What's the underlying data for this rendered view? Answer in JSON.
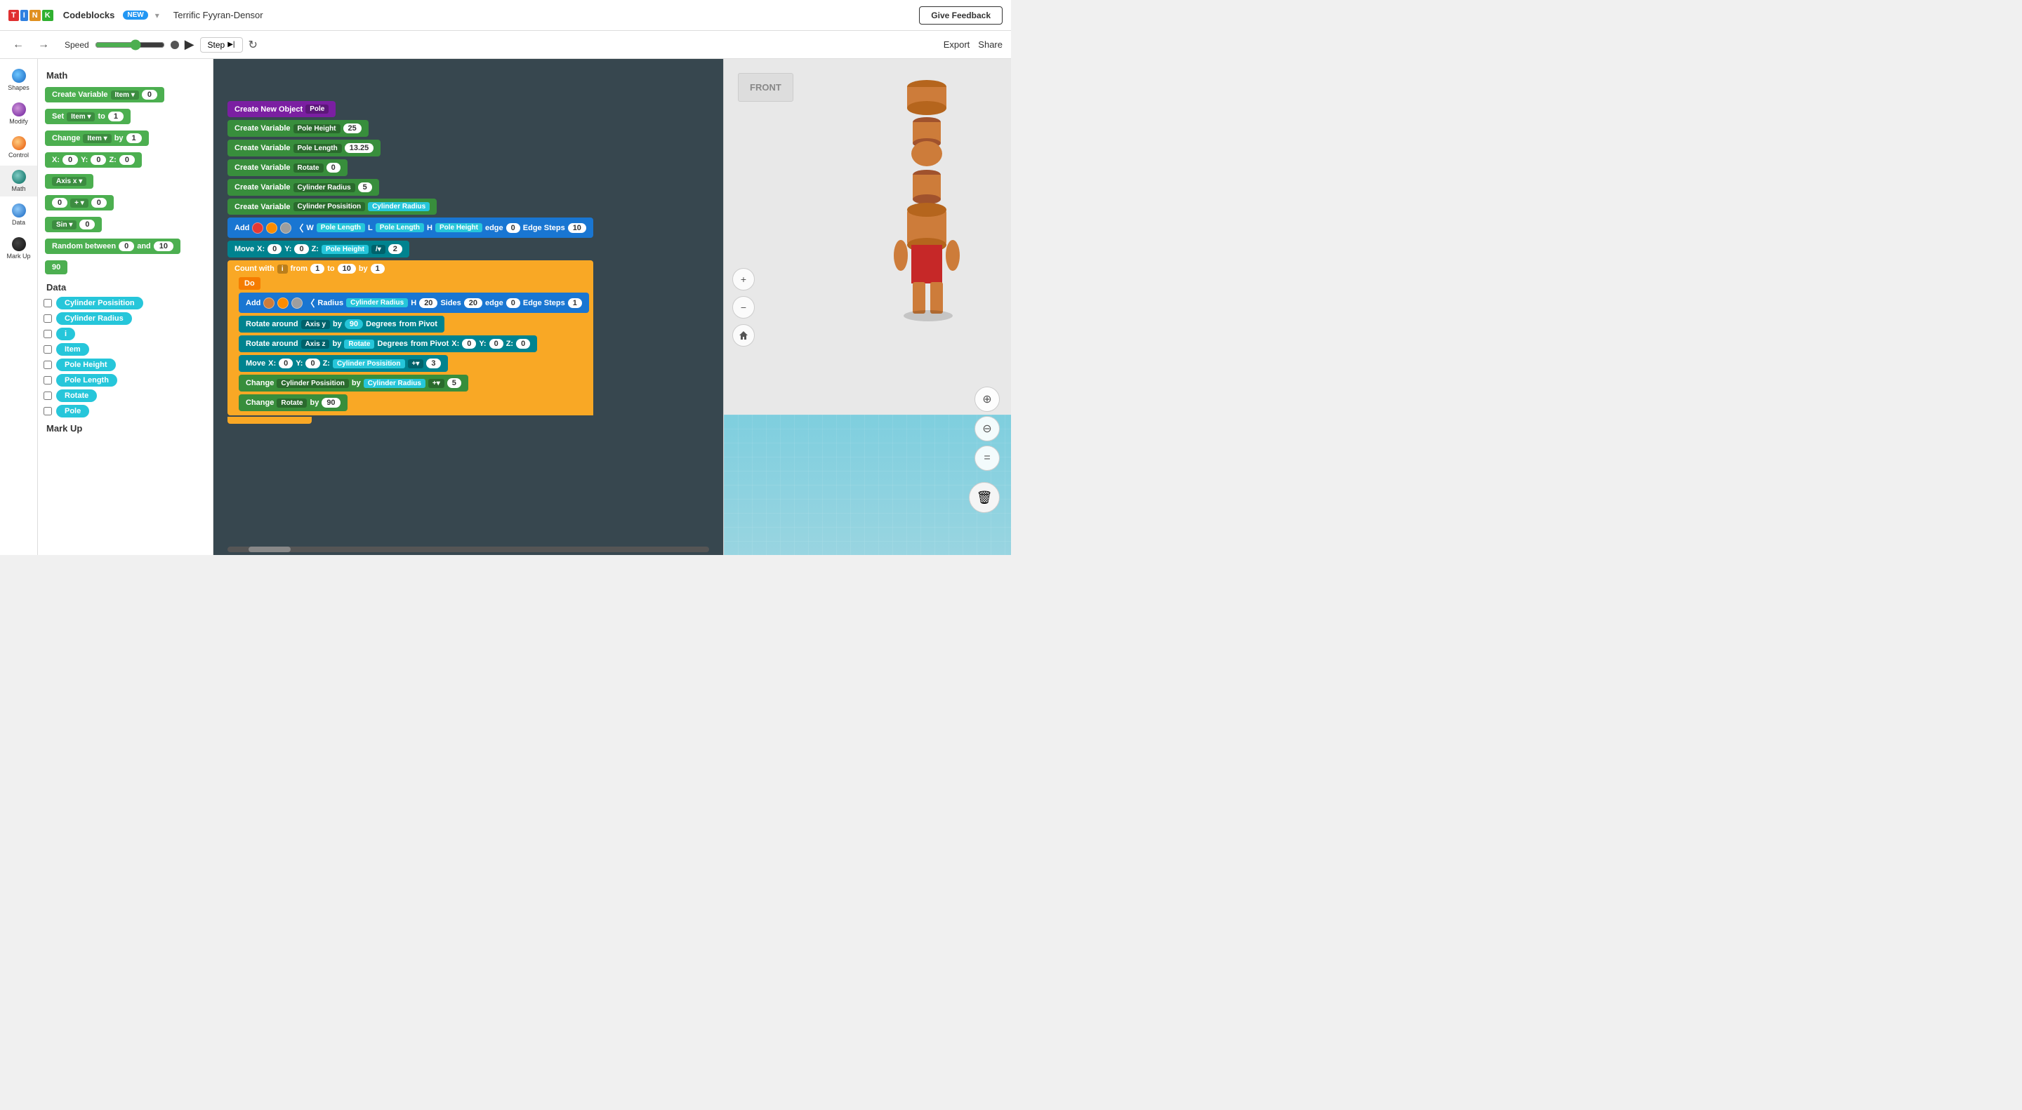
{
  "topbar": {
    "logo": {
      "t": "T",
      "i": "I",
      "n": "N",
      "k": "K"
    },
    "app_name": "Codeblocks",
    "new_badge": "NEW",
    "project_title": "Terrific Fyyran-Densor",
    "give_feedback": "Give Feedback"
  },
  "toolbar": {
    "speed_label": "Speed",
    "step_label": "Step",
    "export_label": "Export",
    "share_label": "Share"
  },
  "sidebar": {
    "items": [
      {
        "label": "Shapes",
        "icon": "shapes-icon"
      },
      {
        "label": "Modify",
        "icon": "modify-icon"
      },
      {
        "label": "Control",
        "icon": "control-icon"
      },
      {
        "label": "Math",
        "icon": "math-icon"
      },
      {
        "label": "Data",
        "icon": "data-icon"
      },
      {
        "label": "Mark Up",
        "icon": "markup-icon"
      }
    ]
  },
  "blocks_panel": {
    "math_title": "Math",
    "data_title": "Data",
    "markup_title": "Mark Up",
    "blocks": [
      {
        "type": "create_variable",
        "label": "Create Variable",
        "var": "Item",
        "val": "0"
      },
      {
        "type": "set",
        "label": "Set",
        "var": "Item",
        "to": "1"
      },
      {
        "type": "change",
        "label": "Change",
        "var": "Item",
        "by": "1"
      },
      {
        "type": "xyz",
        "x": "0",
        "y": "0",
        "z": "0"
      },
      {
        "type": "axis",
        "label": "Axis x"
      },
      {
        "type": "math_op",
        "left": "0",
        "op": "+",
        "right": "0"
      },
      {
        "type": "sin",
        "label": "Sin",
        "val": "0"
      },
      {
        "type": "random",
        "label": "Random between",
        "from": "0",
        "to": "10"
      },
      {
        "type": "number",
        "val": "90"
      }
    ],
    "data_vars": [
      {
        "name": "Cylinder Posisition"
      },
      {
        "name": "Cylinder Radius"
      },
      {
        "name": "i"
      },
      {
        "name": "Item"
      },
      {
        "name": "Pole Height"
      },
      {
        "name": "Pole Length"
      },
      {
        "name": "Rotate"
      },
      {
        "name": "Pole"
      }
    ]
  },
  "code_blocks": {
    "create_new_object": "Create New Object",
    "object_type": "Pole",
    "cv1_label": "Create Variable",
    "cv1_var": "Pole Height",
    "cv1_val": "25",
    "cv2_label": "Create Variable",
    "cv2_var": "Pole Length",
    "cv2_val": "13.25",
    "cv3_label": "Create Variable",
    "cv3_var": "Rotate",
    "cv3_val": "0",
    "cv4_label": "Create Variable",
    "cv4_var": "Cylinder Radius",
    "cv4_val": "5",
    "cv5_label": "Create Variable",
    "cv5_var": "Cylinder Posisition",
    "cv5_ref": "Cylinder Radius",
    "add1_label": "Add",
    "add1_w_label": "W",
    "add1_pole_length": "Pole Length",
    "add1_l_label": "L",
    "add1_pole_length2": "Pole Length",
    "add1_h_label": "H",
    "add1_pole_height": "Pole Height",
    "add1_edge": "edge",
    "add1_edge_val": "0",
    "add1_steps_label": "Edge Steps",
    "add1_steps_val": "10",
    "move1_label": "Move",
    "move1_x": "0",
    "move1_y": "0",
    "move1_z_ref": "Pole Height",
    "move1_op": "/",
    "move1_val": "2",
    "count_label": "Count with",
    "count_var": "i",
    "count_from": "1",
    "count_to": "10",
    "count_by": "1",
    "do_label": "Do",
    "add2_label": "Add",
    "add2_radius_label": "Radius",
    "add2_cyl_radius": "Cylinder Radius",
    "add2_h_label": "H",
    "add2_h_val": "20",
    "add2_sides_label": "Sides",
    "add2_sides_val": "20",
    "add2_edge_label": "edge",
    "add2_edge_val": "0",
    "add2_steps_label": "Edge Steps",
    "add2_steps_val": "1",
    "rotate1_label": "Rotate around",
    "rotate1_axis": "Axis y",
    "rotate1_by": "by",
    "rotate1_val": "90",
    "rotate1_degrees": "Degrees",
    "rotate1_from": "from Pivot",
    "rotate2_label": "Rotate around",
    "rotate2_axis": "Axis z",
    "rotate2_by": "by",
    "rotate2_ref": "Rotate",
    "rotate2_degrees": "Degrees",
    "rotate2_from": "from Pivot",
    "rotate2_x": "0",
    "rotate2_y": "0",
    "rotate2_z": "0",
    "move2_label": "Move",
    "move2_x": "0",
    "move2_y": "0",
    "move2_z_ref": "Cylinder Posisition",
    "move2_op": "+",
    "move2_val": "3",
    "change1_label": "Change",
    "change1_var": "Cylinder Posisition",
    "change1_by": "by",
    "change1_ref": "Cylinder Radius",
    "change1_op": "+",
    "change1_val": "5",
    "change2_label": "Change",
    "change2_var": "Rotate",
    "change2_by": "by",
    "change2_val": "90"
  },
  "viewport": {
    "front_label": "FRONT"
  }
}
